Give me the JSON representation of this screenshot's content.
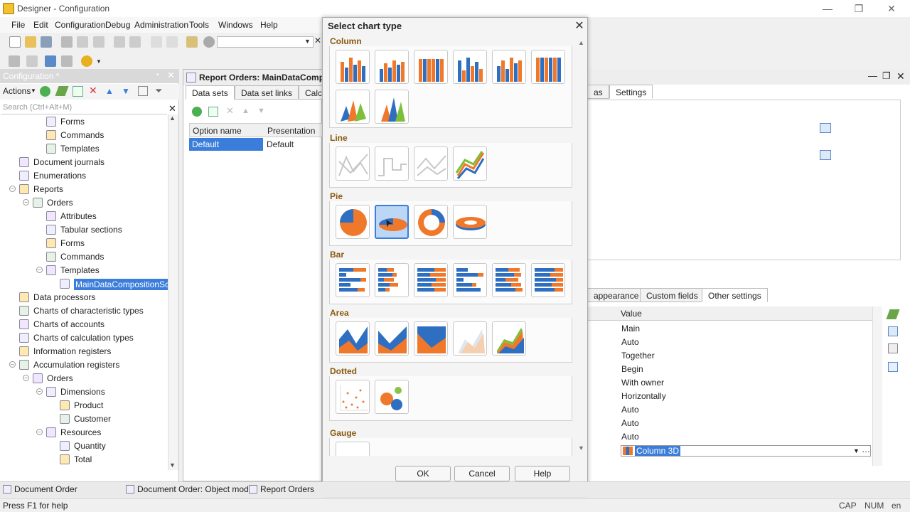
{
  "window": {
    "title": "Designer - Configuration"
  },
  "menu": [
    "File",
    "Edit",
    "Configuration",
    "Debug",
    "Administration",
    "Tools",
    "Windows",
    "Help"
  ],
  "left_panel": {
    "title": "Configuration *",
    "actions_label": "Actions",
    "search_placeholder": "Search (Ctrl+Alt+M)",
    "tree": [
      {
        "label": "Forms",
        "indent": 3
      },
      {
        "label": "Commands",
        "indent": 3
      },
      {
        "label": "Templates",
        "indent": 3
      },
      {
        "label": "Document journals",
        "indent": 1
      },
      {
        "label": "Enumerations",
        "indent": 1
      },
      {
        "label": "Reports",
        "indent": 1,
        "exp": true
      },
      {
        "label": "Orders",
        "indent": 2,
        "exp": true
      },
      {
        "label": "Attributes",
        "indent": 3
      },
      {
        "label": "Tabular sections",
        "indent": 3
      },
      {
        "label": "Forms",
        "indent": 3
      },
      {
        "label": "Commands",
        "indent": 3
      },
      {
        "label": "Templates",
        "indent": 3,
        "exp": true
      },
      {
        "label": "MainDataCompositionScher",
        "indent": 4,
        "selected": true
      },
      {
        "label": "Data processors",
        "indent": 1
      },
      {
        "label": "Charts of characteristic types",
        "indent": 1
      },
      {
        "label": "Charts of accounts",
        "indent": 1
      },
      {
        "label": "Charts of calculation types",
        "indent": 1
      },
      {
        "label": "Information registers",
        "indent": 1
      },
      {
        "label": "Accumulation registers",
        "indent": 1,
        "exp": true
      },
      {
        "label": "Orders",
        "indent": 2,
        "exp": true
      },
      {
        "label": "Dimensions",
        "indent": 3,
        "exp": true
      },
      {
        "label": "Product",
        "indent": 4
      },
      {
        "label": "Customer",
        "indent": 4
      },
      {
        "label": "Resources",
        "indent": 3,
        "exp": true
      },
      {
        "label": "Quantity",
        "indent": 4
      },
      {
        "label": "Total",
        "indent": 4
      }
    ]
  },
  "report_window": {
    "title": "Report Orders: MainDataCompo",
    "tabs": [
      "Data sets",
      "Data set links",
      "Calcu"
    ],
    "grid_headers": [
      "Option name",
      "Presentation"
    ],
    "row": [
      "Default",
      "Default"
    ]
  },
  "right_panel": {
    "tabs_top": [
      "as",
      "Settings"
    ],
    "tabs_mid": [
      "appearance",
      "Custom fields",
      "Other settings"
    ],
    "value_header": "Value",
    "values": [
      "Main",
      "Auto",
      "Together",
      "Begin",
      "With owner",
      "Horizontally",
      "Auto",
      "Auto",
      "Auto"
    ],
    "selected_value": "Column 3D"
  },
  "dialog": {
    "title": "Select chart type",
    "sections": [
      {
        "title": "Column",
        "count": 8
      },
      {
        "title": "Line",
        "count": 4
      },
      {
        "title": "Pie",
        "count": 4
      },
      {
        "title": "Bar",
        "count": 6
      },
      {
        "title": "Area",
        "count": 5
      },
      {
        "title": "Dotted",
        "count": 2
      },
      {
        "title": "Gauge",
        "count": 1
      }
    ],
    "buttons": {
      "ok": "OK",
      "cancel": "Cancel",
      "help": "Help"
    }
  },
  "taskbar": [
    "Document Order",
    "Document Order: Object mod...",
    "Report Orders"
  ],
  "status": {
    "help": "Press F1 for help",
    "indicators": [
      "CAP",
      "NUM",
      "en"
    ]
  },
  "colors": {
    "accent": "#3b7ddb",
    "orange": "#f0782a",
    "blue": "#2e6fc2"
  }
}
